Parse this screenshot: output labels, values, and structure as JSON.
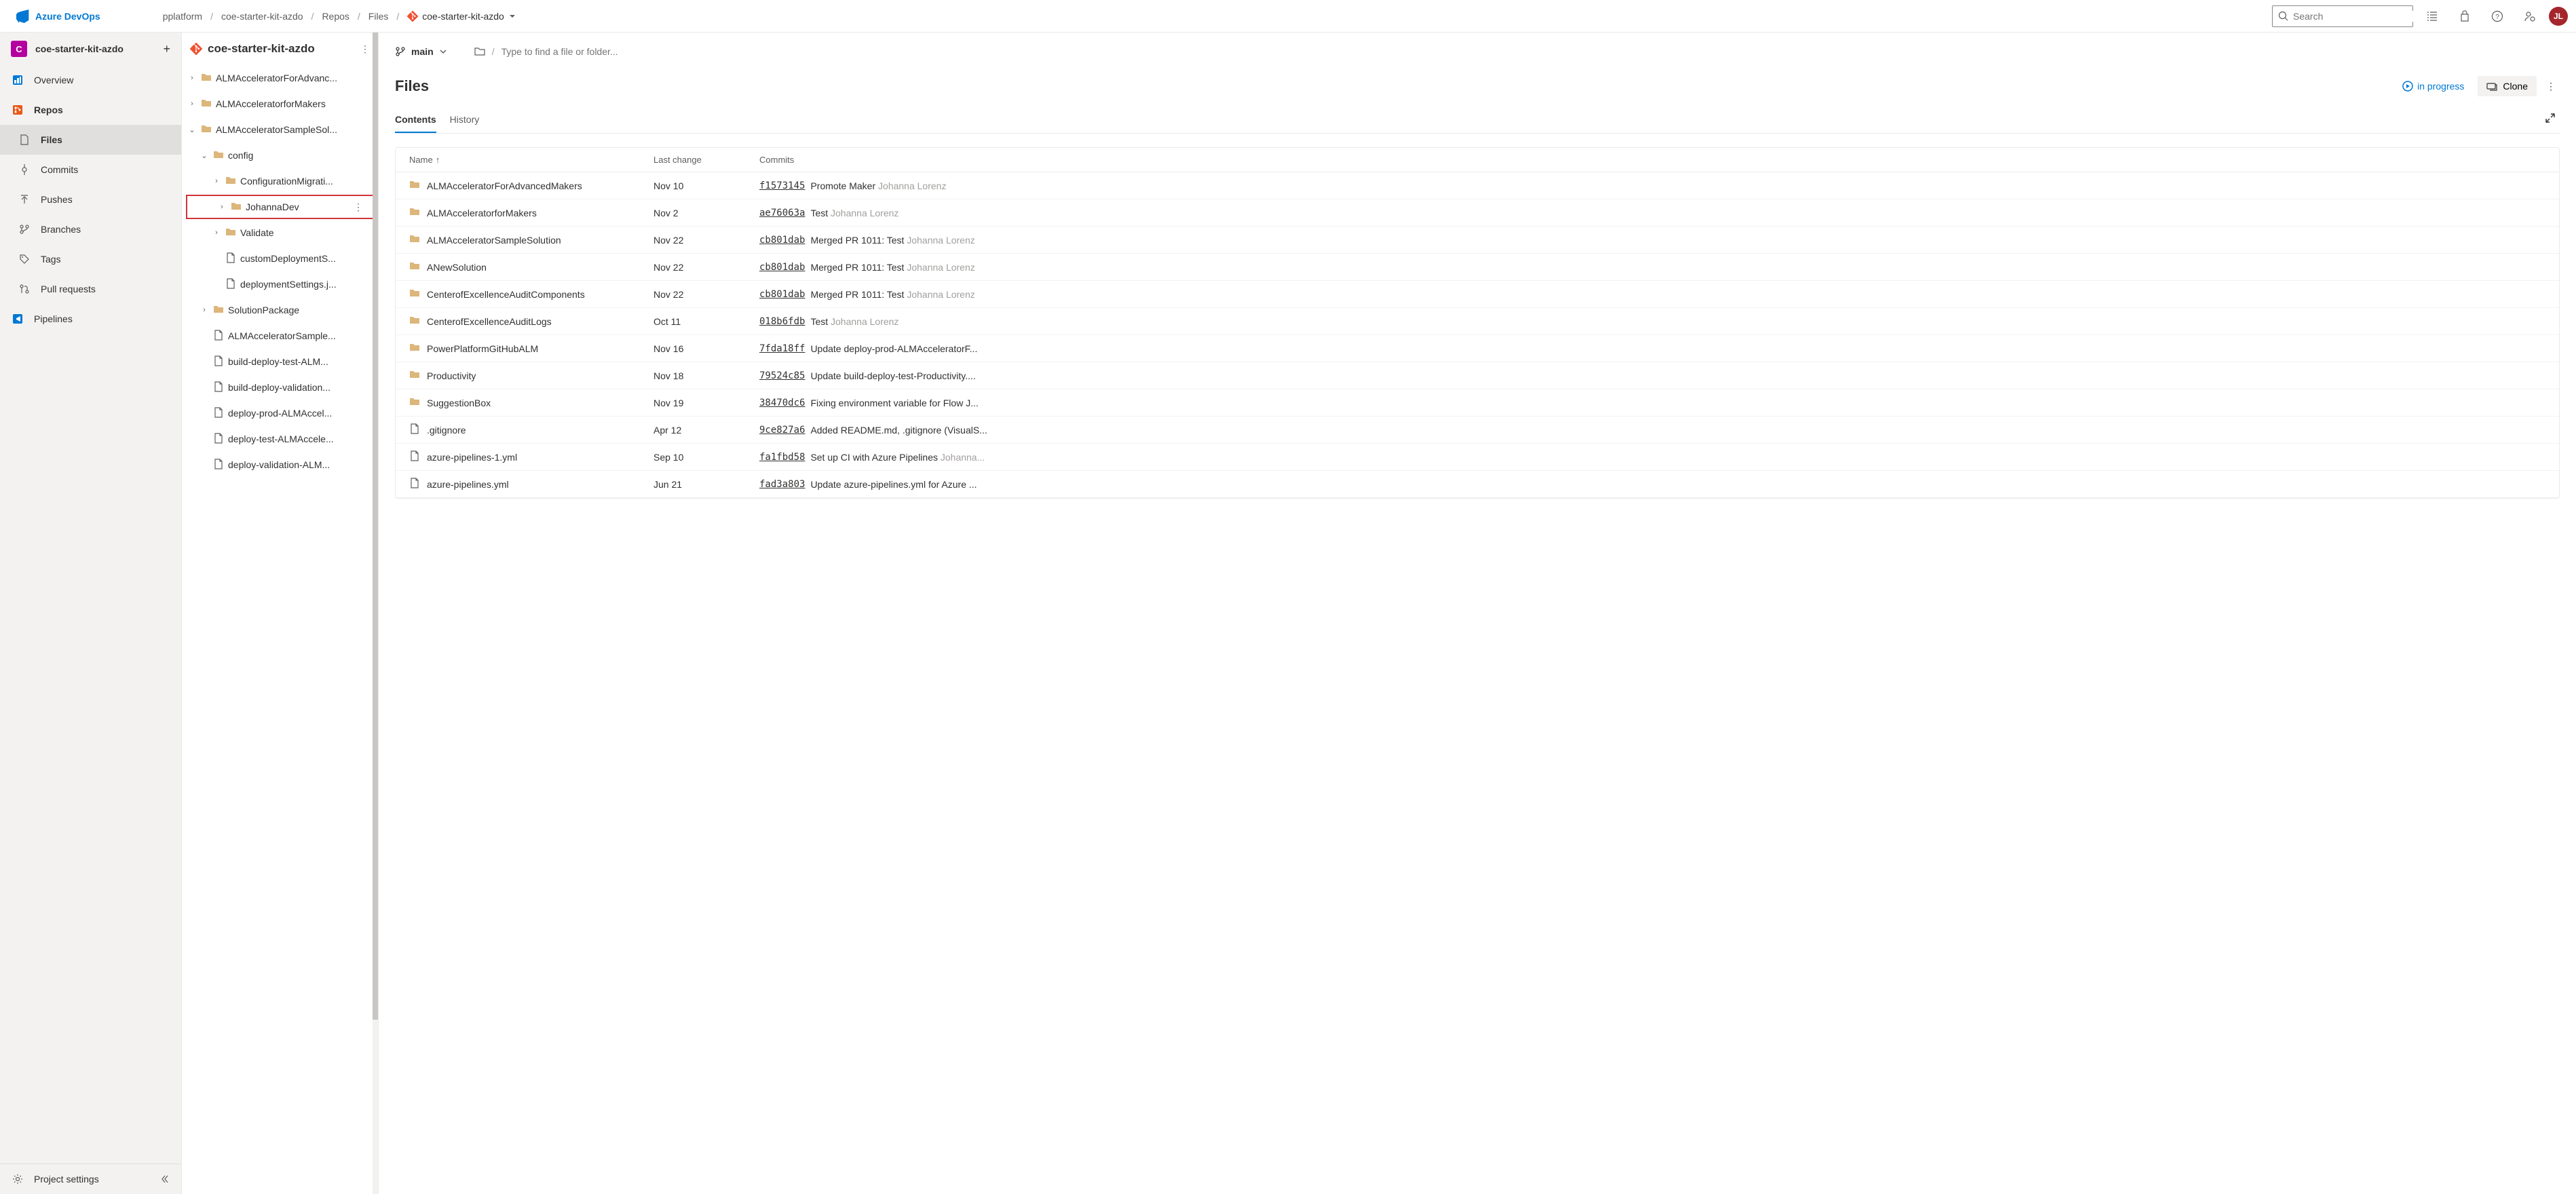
{
  "brand": "Azure DevOps",
  "breadcrumbs": [
    "pplatform",
    "coe-starter-kit-azdo",
    "Repos",
    "Files"
  ],
  "breadcrumb_last": "coe-starter-kit-azdo",
  "search_placeholder": "Search",
  "avatar_initials": "JL",
  "project": {
    "name": "coe-starter-kit-azdo",
    "letter": "C"
  },
  "nav": {
    "overview": "Overview",
    "repos": "Repos",
    "files": "Files",
    "commits": "Commits",
    "pushes": "Pushes",
    "branches": "Branches",
    "tags": "Tags",
    "pull_requests": "Pull requests",
    "pipelines": "Pipelines",
    "project_settings": "Project settings"
  },
  "tree": {
    "repo": "coe-starter-kit-azdo",
    "items": [
      {
        "t": "folder",
        "exp": "closed",
        "ind": 0,
        "label": "ALMAcceleratorForAdvanc..."
      },
      {
        "t": "folder",
        "exp": "closed",
        "ind": 0,
        "label": "ALMAcceleratorforMakers"
      },
      {
        "t": "folder",
        "exp": "open",
        "ind": 0,
        "label": "ALMAcceleratorSampleSol..."
      },
      {
        "t": "folder",
        "exp": "open",
        "ind": 1,
        "label": "config"
      },
      {
        "t": "folder",
        "exp": "closed",
        "ind": 2,
        "label": "ConfigurationMigrati..."
      },
      {
        "t": "folder",
        "exp": "closed",
        "ind": 2,
        "label": "JohannaDev",
        "hl": true,
        "more": true
      },
      {
        "t": "folder",
        "exp": "closed",
        "ind": 2,
        "label": "Validate"
      },
      {
        "t": "file",
        "ind": 2,
        "label": "customDeploymentS..."
      },
      {
        "t": "file",
        "ind": 2,
        "label": "deploymentSettings.j..."
      },
      {
        "t": "folder",
        "exp": "closed",
        "ind": 1,
        "label": "SolutionPackage"
      },
      {
        "t": "file",
        "ind": 1,
        "label": "ALMAcceleratorSample..."
      },
      {
        "t": "file",
        "ind": 1,
        "label": "build-deploy-test-ALM..."
      },
      {
        "t": "file",
        "ind": 1,
        "label": "build-deploy-validation..."
      },
      {
        "t": "file",
        "ind": 1,
        "label": "deploy-prod-ALMAccel..."
      },
      {
        "t": "file",
        "ind": 1,
        "label": "deploy-test-ALMAccele..."
      },
      {
        "t": "file",
        "ind": 1,
        "label": "deploy-validation-ALM..."
      }
    ]
  },
  "branch": "main",
  "path_placeholder": "Type to find a file or folder...",
  "page_title": "Files",
  "in_progress": "in progress",
  "clone": "Clone",
  "tabs": {
    "contents": "Contents",
    "history": "History"
  },
  "columns": {
    "name": "Name",
    "lastchange": "Last change",
    "commits": "Commits"
  },
  "rows": [
    {
      "t": "folder",
      "name": "ALMAcceleratorForAdvancedMakers",
      "date": "Nov 10",
      "hash": "f1573145",
      "msg": "Promote Maker",
      "author": "Johanna Lorenz"
    },
    {
      "t": "folder",
      "name": "ALMAcceleratorforMakers",
      "date": "Nov 2",
      "hash": "ae76063a",
      "msg": "Test",
      "author": "Johanna Lorenz"
    },
    {
      "t": "folder",
      "name": "ALMAcceleratorSampleSolution",
      "date": "Nov 22",
      "hash": "cb801dab",
      "msg": "Merged PR 1011: Test",
      "author": "Johanna Lorenz"
    },
    {
      "t": "folder",
      "name": "ANewSolution",
      "date": "Nov 22",
      "hash": "cb801dab",
      "msg": "Merged PR 1011: Test",
      "author": "Johanna Lorenz"
    },
    {
      "t": "folder",
      "name": "CenterofExcellenceAuditComponents",
      "date": "Nov 22",
      "hash": "cb801dab",
      "msg": "Merged PR 1011: Test",
      "author": "Johanna Lorenz"
    },
    {
      "t": "folder",
      "name": "CenterofExcellenceAuditLogs",
      "date": "Oct 11",
      "hash": "018b6fdb",
      "msg": "Test",
      "author": "Johanna Lorenz"
    },
    {
      "t": "folder",
      "name": "PowerPlatformGitHubALM",
      "date": "Nov 16",
      "hash": "7fda18ff",
      "msg": "Update deploy-prod-ALMAcceleratorF...",
      "author": ""
    },
    {
      "t": "folder",
      "name": "Productivity",
      "date": "Nov 18",
      "hash": "79524c85",
      "msg": "Update build-deploy-test-Productivity....",
      "author": ""
    },
    {
      "t": "folder",
      "name": "SuggestionBox",
      "date": "Nov 19",
      "hash": "38470dc6",
      "msg": "Fixing environment variable for Flow J...",
      "author": ""
    },
    {
      "t": "file",
      "name": ".gitignore",
      "date": "Apr 12",
      "hash": "9ce827a6",
      "msg": "Added README.md, .gitignore (VisualS...",
      "author": ""
    },
    {
      "t": "file",
      "name": "azure-pipelines-1.yml",
      "date": "Sep 10",
      "hash": "fa1fbd58",
      "msg": "Set up CI with Azure Pipelines",
      "author": "Johanna..."
    },
    {
      "t": "file",
      "name": "azure-pipelines.yml",
      "date": "Jun 21",
      "hash": "fad3a803",
      "msg": "Update azure-pipelines.yml for Azure ...",
      "author": ""
    }
  ]
}
